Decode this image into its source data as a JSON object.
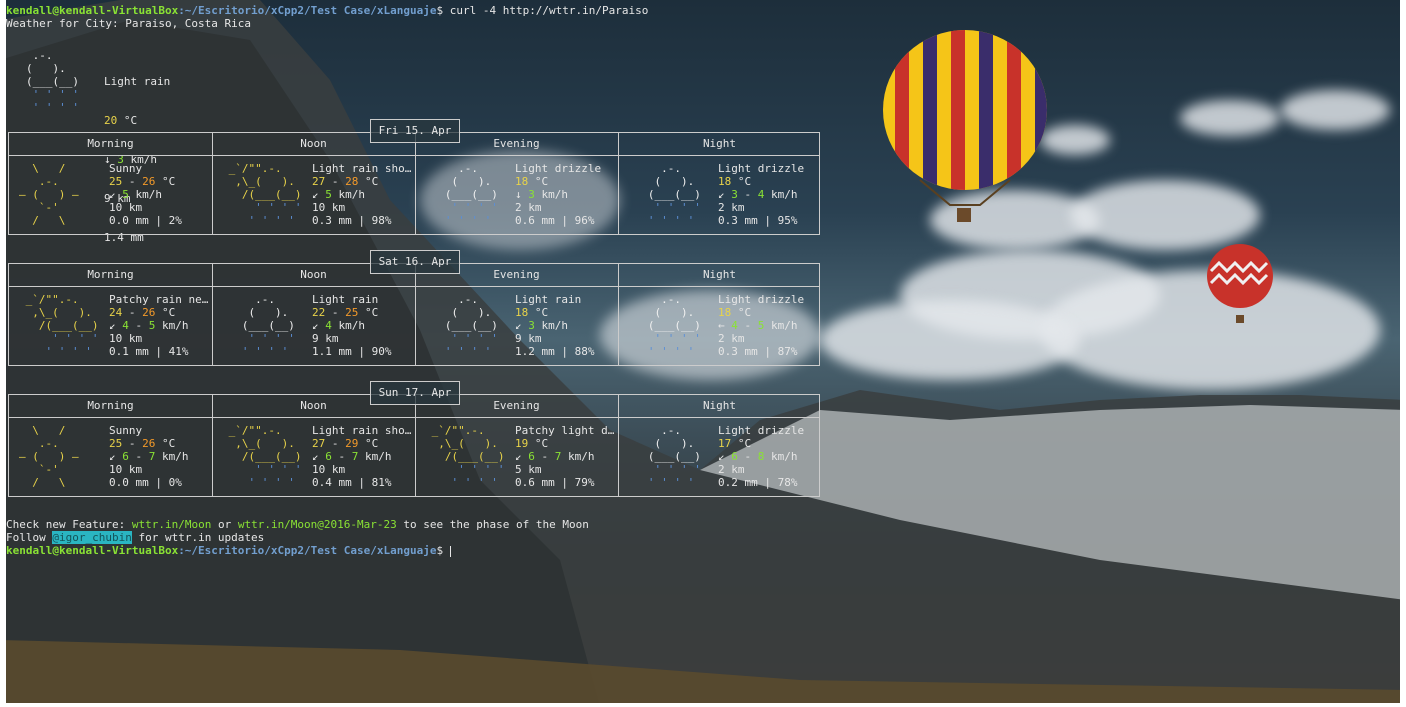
{
  "terminal": {
    "prompt_user": "kendall@kendall-VirtualBox",
    "prompt_path": ":~/Escritorio/xCpp2/Test Case/xLanguaje",
    "prompt_symbol": "$",
    "command": "curl -4 http://wttr.in/Paraiso",
    "location_line": "Weather for City: Paraiso, Costa Rica",
    "footer_line1_prefix": "Check new Feature: ",
    "footer_link1": "wttr.in/Moon",
    "footer_or": " or ",
    "footer_link2": "wttr.in/Moon@2016-Mar-23",
    "footer_line1_suffix": " to see the phase of the Moon",
    "footer_line2_prefix": "Follow ",
    "footer_handle": "@igor_chubin",
    "footer_line2_suffix": " for wttr.in updates"
  },
  "current": {
    "art": [
      " .-.",
      "(   ).",
      "(___(__)",
      " ' ' ' '",
      " ' ' ' '"
    ],
    "condition": "Light rain",
    "temp": "20",
    "temp_unit": " °C",
    "wind_arrow": "↓",
    "wind_speed": "3",
    "wind_unit": " km/h",
    "visibility": "9 km",
    "precip": "1.4 mm"
  },
  "column_headers": [
    "Morning",
    "Noon",
    "Evening",
    "Night"
  ],
  "days": [
    {
      "label": "Fri 15. Apr",
      "cells": [
        {
          "art": [
            "  \\   /",
            "   .-.",
            "― (   ) ―",
            "   `-'",
            "  /   \\"
          ],
          "art_color": "#e8d34a",
          "condition": "Sunny",
          "temp_a": "25",
          "temp_b": "26",
          "wind_arrow": "↙",
          "wind_a": "5",
          "wind_b": "",
          "vis": "10 km",
          "precip": "0.0 mm | 2%"
        },
        {
          "art": [
            " _`/\"\".-.",
            "  ,\\_(   ).",
            "   /(___(__)",
            "     ' ' ' '",
            "    ' ' ' '"
          ],
          "art_color": "#e8d34a",
          "condition": "Light rain sho…",
          "temp_a": "27",
          "temp_b": "28",
          "wind_arrow": "↙",
          "wind_a": "5",
          "wind_b": "",
          "vis": "10 km",
          "precip": "0.3 mm | 98%"
        },
        {
          "art": [
            "     .-.",
            "    (   ).",
            "   (___(__)",
            "    ' ' ' '",
            "   ' ' ' '"
          ],
          "art_color": "#f0f0f0",
          "condition": "Light drizzle",
          "temp_a": "18",
          "temp_b": "",
          "wind_arrow": "↓",
          "wind_a": "3",
          "wind_b": "",
          "vis": "2 km",
          "precip": "0.6 mm | 96%"
        },
        {
          "art": [
            "     .-.",
            "    (   ).",
            "   (___(__)",
            "    ' ' ' '",
            "   ' ' ' '"
          ],
          "art_color": "#f0f0f0",
          "condition": "Light drizzle",
          "temp_a": "18",
          "temp_b": "",
          "wind_arrow": "↙",
          "wind_a": "3",
          "wind_b": "4",
          "vis": "2 km",
          "precip": "0.3 mm | 95%"
        }
      ]
    },
    {
      "label": "Sat 16. Apr",
      "cells": [
        {
          "art": [
            " _`/\"\".-.",
            "  ,\\_(   ).",
            "   /(___(__)",
            "     ' ' ' '",
            "    ' ' ' '"
          ],
          "art_color": "#e8d34a",
          "condition": "Patchy rain ne…",
          "temp_a": "24",
          "temp_b": "26",
          "wind_arrow": "↙",
          "wind_a": "4",
          "wind_b": "5",
          "vis": "10 km",
          "precip": "0.1 mm | 41%"
        },
        {
          "art": [
            "     .-.",
            "    (   ).",
            "   (___(__)",
            "    ' ' ' '",
            "   ' ' ' '"
          ],
          "art_color": "#f0f0f0",
          "condition": "Light rain",
          "temp_a": "22",
          "temp_b": "25",
          "wind_arrow": "↙",
          "wind_a": "4",
          "wind_b": "",
          "vis": "9 km",
          "precip": "1.1 mm | 90%"
        },
        {
          "art": [
            "     .-.",
            "    (   ).",
            "   (___(__)",
            "    ' ' ' '",
            "   ' ' ' '"
          ],
          "art_color": "#f0f0f0",
          "condition": "Light rain",
          "temp_a": "18",
          "temp_b": "",
          "wind_arrow": "↙",
          "wind_a": "3",
          "wind_b": "",
          "vis": "9 km",
          "precip": "1.2 mm | 88%"
        },
        {
          "art": [
            "     .-.",
            "    (   ).",
            "   (___(__)",
            "    ' ' ' '",
            "   ' ' ' '"
          ],
          "art_color": "#f0f0f0",
          "condition": "Light drizzle",
          "temp_a": "18",
          "temp_b": "",
          "wind_arrow": "←",
          "wind_a": "4",
          "wind_b": "5",
          "vis": "2 km",
          "precip": "0.3 mm | 87%"
        }
      ]
    },
    {
      "label": "Sun 17. Apr",
      "cells": [
        {
          "art": [
            "  \\   /",
            "   .-.",
            "― (   ) ―",
            "   `-'",
            "  /   \\"
          ],
          "art_color": "#e8d34a",
          "condition": "Sunny",
          "temp_a": "25",
          "temp_b": "26",
          "wind_arrow": "↙",
          "wind_a": "6",
          "wind_b": "7",
          "vis": "10 km",
          "precip": "0.0 mm | 0%"
        },
        {
          "art": [
            " _`/\"\".-.",
            "  ,\\_(   ).",
            "   /(___(__)",
            "     ' ' ' '",
            "    ' ' ' '"
          ],
          "art_color": "#e8d34a",
          "condition": "Light rain sho…",
          "temp_a": "27",
          "temp_b": "29",
          "wind_arrow": "↙",
          "wind_a": "6",
          "wind_b": "7",
          "vis": "10 km",
          "precip": "0.4 mm | 81%"
        },
        {
          "art": [
            " _`/\"\".-.",
            "  ,\\_(   ).",
            "   /(___(__)",
            "     ' ' ' '",
            "    ' ' ' '"
          ],
          "art_color": "#e8d34a",
          "condition": "Patchy light d…",
          "temp_a": "19",
          "temp_b": "",
          "wind_arrow": "↙",
          "wind_a": "6",
          "wind_b": "7",
          "vis": "5 km",
          "precip": "0.6 mm | 79%"
        },
        {
          "art": [
            "     .-.",
            "    (   ).",
            "   (___(__)",
            "    ' ' ' '",
            "   ' ' ' '"
          ],
          "art_color": "#f0f0f0",
          "condition": "Light drizzle",
          "temp_a": "17",
          "temp_b": "",
          "wind_arrow": "↙",
          "wind_a": "6",
          "wind_b": "8",
          "vis": "2 km",
          "precip": "0.2 mm | 78%"
        }
      ]
    }
  ],
  "units": {
    "temp": " °C",
    "wind": " km/h"
  },
  "colors": {
    "prompt_user": "#8ae234",
    "prompt_path": "#729fcf",
    "temp": "#e8d34a",
    "wind": "#8ae234",
    "rain": "#5c8fd6",
    "handle_bg": "#2ab5c2"
  }
}
